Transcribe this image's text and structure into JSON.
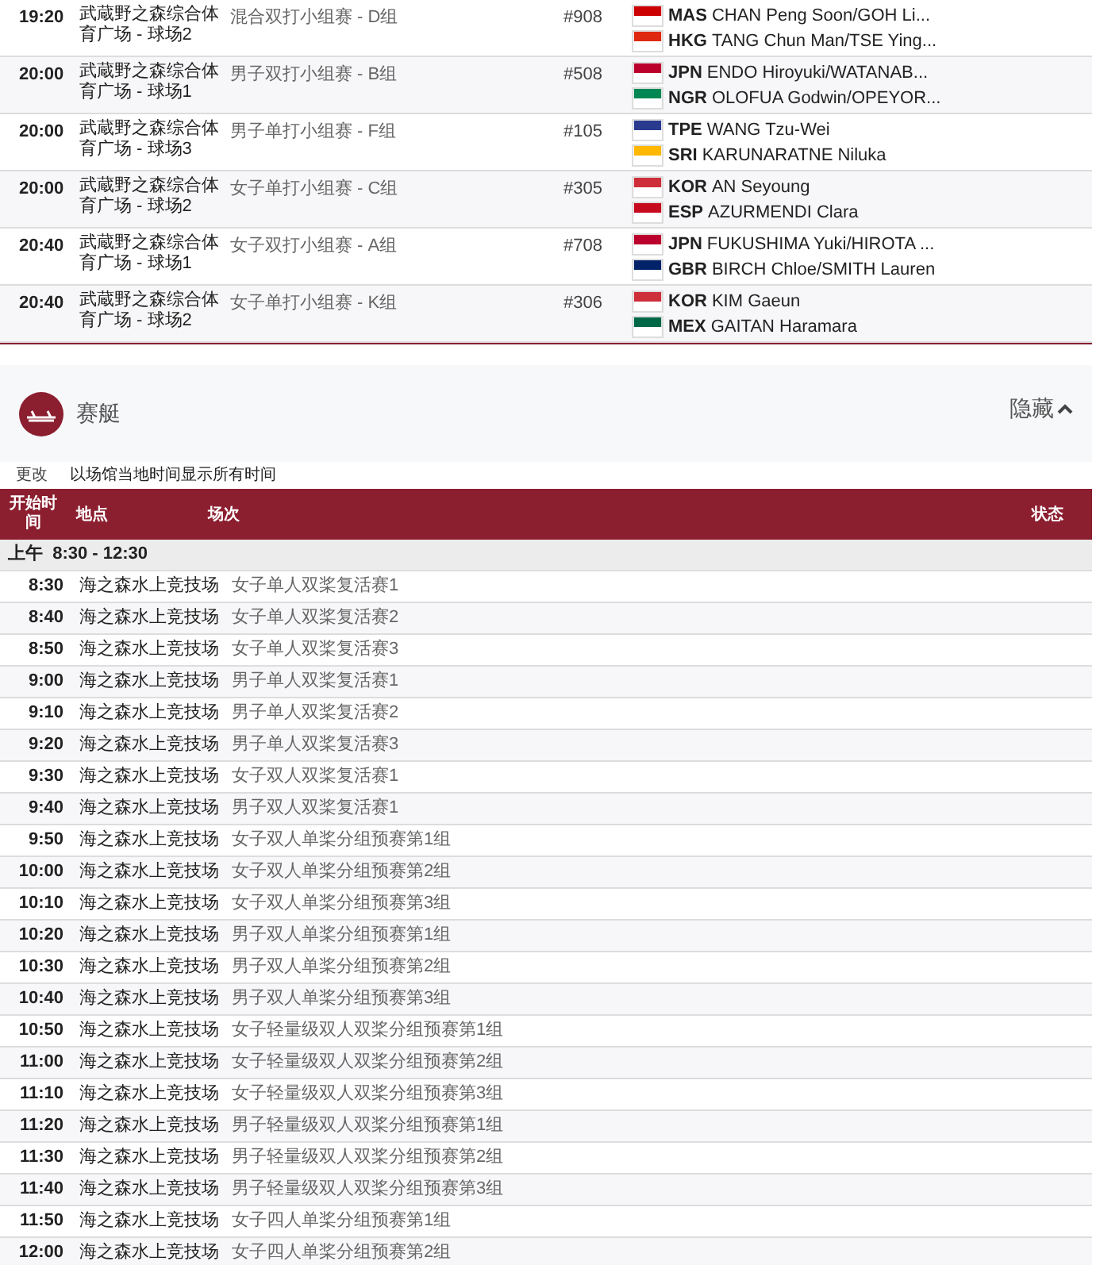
{
  "matches": [
    {
      "time": "19:20",
      "venue": "武蔵野之森综合体育广场 - 球场2",
      "event": "混合双打小组赛 - D组",
      "number": "#908",
      "teams": [
        {
          "code": "MAS",
          "names": "CHAN Peng Soon/GOH Li...",
          "color": "#cc0001"
        },
        {
          "code": "HKG",
          "names": "TANG Chun Man/TSE Ying...",
          "color": "#de2910"
        }
      ]
    },
    {
      "time": "20:00",
      "venue": "武蔵野之森综合体育广场 - 球场1",
      "event": "男子双打小组赛 - B组",
      "number": "#508",
      "teams": [
        {
          "code": "JPN",
          "names": "ENDO Hiroyuki/WATANAB...",
          "color": "#bc002d"
        },
        {
          "code": "NGR",
          "names": "OLOFUA Godwin/OPEYOR...",
          "color": "#008751"
        }
      ]
    },
    {
      "time": "20:00",
      "venue": "武蔵野之森综合体育广场 - 球场3",
      "event": "男子单打小组赛 - F组",
      "number": "#105",
      "teams": [
        {
          "code": "TPE",
          "names": "WANG Tzu-Wei",
          "color": "#2a3b8f"
        },
        {
          "code": "SRI",
          "names": "KARUNARATNE Niluka",
          "color": "#ffb700"
        }
      ]
    },
    {
      "time": "20:00",
      "venue": "武蔵野之森综合体育广场 - 球场2",
      "event": "女子单打小组赛 - C组",
      "number": "#305",
      "teams": [
        {
          "code": "KOR",
          "names": "AN Seyoung",
          "color": "#cd2e3a"
        },
        {
          "code": "ESP",
          "names": "AZURMENDI Clara",
          "color": "#c60b1e"
        }
      ]
    },
    {
      "time": "20:40",
      "venue": "武蔵野之森综合体育广场 - 球场1",
      "event": "女子双打小组赛 - A组",
      "number": "#708",
      "teams": [
        {
          "code": "JPN",
          "names": "FUKUSHIMA Yuki/HIROTA ...",
          "color": "#bc002d"
        },
        {
          "code": "GBR",
          "names": "BIRCH Chloe/SMITH Lauren",
          "color": "#012169"
        }
      ]
    },
    {
      "time": "20:40",
      "venue": "武蔵野之森综合体育广场 - 球场2",
      "event": "女子单打小组赛 - K组",
      "number": "#306",
      "teams": [
        {
          "code": "KOR",
          "names": "KIM Gaeun",
          "color": "#cd2e3a"
        },
        {
          "code": "MEX",
          "names": "GAITAN Haramara",
          "color": "#006847"
        }
      ]
    }
  ],
  "sport": {
    "title": "赛艇",
    "toggle": "隐藏",
    "change": "更改",
    "timezone_note": "以场馆当地时间显示所有时间"
  },
  "table": {
    "columns": [
      "开始时间",
      "地点",
      "场次",
      "状态"
    ],
    "session": "上午  8:30 - 12:30",
    "rows": [
      {
        "time": "8:30",
        "venue": "海之森水上竞技场",
        "event": "女子单人双桨复活赛1"
      },
      {
        "time": "8:40",
        "venue": "海之森水上竞技场",
        "event": "女子单人双桨复活赛2"
      },
      {
        "time": "8:50",
        "venue": "海之森水上竞技场",
        "event": "女子单人双桨复活赛3"
      },
      {
        "time": "9:00",
        "venue": "海之森水上竞技场",
        "event": "男子单人双桨复活赛1"
      },
      {
        "time": "9:10",
        "venue": "海之森水上竞技场",
        "event": "男子单人双桨复活赛2"
      },
      {
        "time": "9:20",
        "venue": "海之森水上竞技场",
        "event": "男子单人双桨复活赛3"
      },
      {
        "time": "9:30",
        "venue": "海之森水上竞技场",
        "event": "女子双人双桨复活赛1"
      },
      {
        "time": "9:40",
        "venue": "海之森水上竞技场",
        "event": "男子双人双桨复活赛1"
      },
      {
        "time": "9:50",
        "venue": "海之森水上竞技场",
        "event": "女子双人单桨分组预赛第1组"
      },
      {
        "time": "10:00",
        "venue": "海之森水上竞技场",
        "event": "女子双人单桨分组预赛第2组"
      },
      {
        "time": "10:10",
        "venue": "海之森水上竞技场",
        "event": "女子双人单桨分组预赛第3组"
      },
      {
        "time": "10:20",
        "venue": "海之森水上竞技场",
        "event": "男子双人单桨分组预赛第1组"
      },
      {
        "time": "10:30",
        "venue": "海之森水上竞技场",
        "event": "男子双人单桨分组预赛第2组"
      },
      {
        "time": "10:40",
        "venue": "海之森水上竞技场",
        "event": "男子双人单桨分组预赛第3组"
      },
      {
        "time": "10:50",
        "venue": "海之森水上竞技场",
        "event": "女子轻量级双人双桨分组预赛第1组"
      },
      {
        "time": "11:00",
        "venue": "海之森水上竞技场",
        "event": "女子轻量级双人双桨分组预赛第2组"
      },
      {
        "time": "11:10",
        "venue": "海之森水上竞技场",
        "event": "女子轻量级双人双桨分组预赛第3组"
      },
      {
        "time": "11:20",
        "venue": "海之森水上竞技场",
        "event": "男子轻量级双人双桨分组预赛第1组"
      },
      {
        "time": "11:30",
        "venue": "海之森水上竞技场",
        "event": "男子轻量级双人双桨分组预赛第2组"
      },
      {
        "time": "11:40",
        "venue": "海之森水上竞技场",
        "event": "男子轻量级双人双桨分组预赛第3组"
      },
      {
        "time": "11:50",
        "venue": "海之森水上竞技场",
        "event": "女子四人单桨分组预赛第1组"
      },
      {
        "time": "12:00",
        "venue": "海之森水上竞技场",
        "event": "女子四人单桨分组预赛第2组"
      }
    ]
  }
}
